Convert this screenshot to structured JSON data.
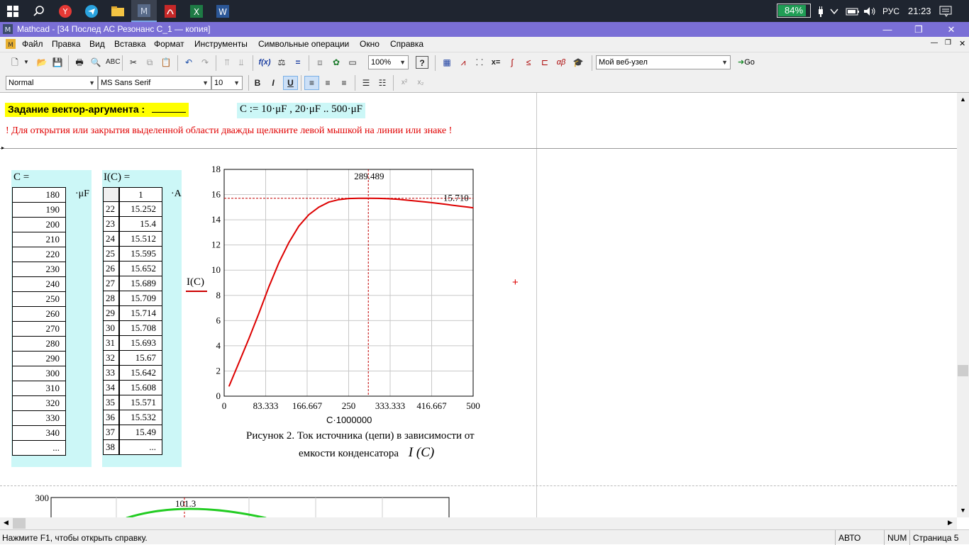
{
  "taskbar": {
    "battery_label": "84%",
    "battery_level": 0.84,
    "lang": "РУС",
    "clock": "21:23"
  },
  "window": {
    "title": "Mathcad - [34 Послед АС Резонанс С_1 — копия]",
    "minimize": "—",
    "maximize": "❐",
    "close": "✕"
  },
  "menu": {
    "items": [
      "Файл",
      "Правка",
      "Вид",
      "Вставка",
      "Формат",
      "Инструменты",
      "Символьные операции",
      "Окно",
      "Справка"
    ]
  },
  "toolbar": {
    "zoom": "100%",
    "web_node": "Мой веб-узел",
    "go_label": "Go",
    "style": "Normal",
    "font": "MS Sans Serif",
    "size": "10",
    "bold": "B",
    "italic": "I",
    "underline": "U"
  },
  "sheet": {
    "task_label": "Задание  вектор-аргумента :",
    "definition": "C := 10·μF , 20·μF .. 500·μF",
    "hint": "! Для открытия или закрытия выделенной области дважды щелкните левой мышкой на линии или знаке !",
    "c_label": "C  =",
    "c_unit": "·μF",
    "c_values": [
      "180",
      "190",
      "200",
      "210",
      "220",
      "230",
      "240",
      "250",
      "260",
      "270",
      "280",
      "290",
      "300",
      "310",
      "320",
      "330",
      "340",
      "..."
    ],
    "i_label": "I(C)  =",
    "i_unit": "·A",
    "i_header": "1",
    "i_index": [
      "22",
      "23",
      "24",
      "25",
      "26",
      "27",
      "28",
      "29",
      "30",
      "31",
      "32",
      "33",
      "34",
      "35",
      "36",
      "37",
      "38"
    ],
    "i_values": [
      "15.252",
      "15.4",
      "15.512",
      "15.595",
      "15.652",
      "15.689",
      "15.709",
      "15.714",
      "15.708",
      "15.693",
      "15.67",
      "15.642",
      "15.608",
      "15.571",
      "15.532",
      "15.49",
      "..."
    ],
    "plot_ylabel": "I(C)",
    "plot_xlabel": "C·1000000",
    "caption_line1": "Рисунок 2.  Ток источника (цепи) в зависимости от",
    "caption_line2": "емкости конденсатора",
    "caption_expr": "I (C)",
    "marker_x_label": "289.489",
    "marker_y_label": "15.710",
    "plot2_ytick": "300",
    "plot2_marker_label": "101.3"
  },
  "chart_data": {
    "type": "line",
    "title": "",
    "xlabel": "C·1000000",
    "ylabel": "I(C)",
    "xlim": [
      0,
      500
    ],
    "ylim": [
      0,
      18
    ],
    "xticks": [
      "0",
      "83.333",
      "166.667",
      "250",
      "333.333",
      "416.667",
      "500"
    ],
    "yticks": [
      "0",
      "2",
      "4",
      "6",
      "8",
      "10",
      "12",
      "14",
      "16",
      "18"
    ],
    "grid": true,
    "marker_x": 289.489,
    "marker_y": 15.71,
    "color": "#dd0000",
    "series": [
      {
        "x": [
          10,
          30,
          50,
          70,
          90,
          110,
          130,
          150,
          170,
          190,
          210,
          230,
          250,
          270,
          290,
          310,
          330,
          350,
          370,
          390,
          410,
          430,
          450,
          470,
          490,
          500
        ],
        "values": [
          0.8,
          2.7,
          4.6,
          6.6,
          8.7,
          10.6,
          12.2,
          13.5,
          14.4,
          15.0,
          15.4,
          15.6,
          15.69,
          15.708,
          15.71,
          15.7,
          15.67,
          15.62,
          15.55,
          15.47,
          15.39,
          15.3,
          15.2,
          15.1,
          15.0,
          14.95
        ]
      }
    ]
  },
  "status": {
    "help": "Нажмите F1, чтобы открыть справку.",
    "mode": "АВТО",
    "num": "NUM",
    "page": "Страница 5"
  }
}
